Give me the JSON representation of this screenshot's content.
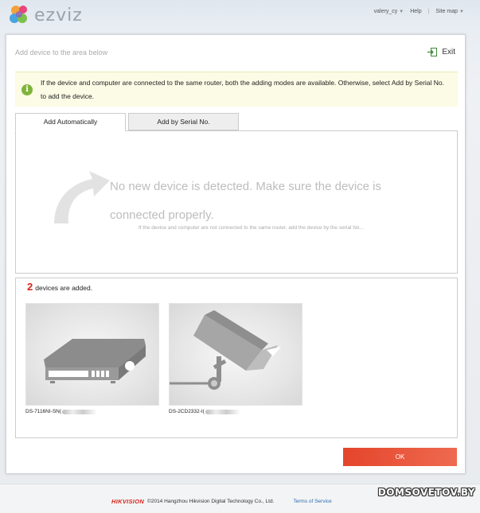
{
  "header": {
    "logo_text": "ezviz",
    "user": "valery_cy",
    "help": "Help",
    "site_map": "Site map"
  },
  "panel": {
    "title": "Add device to the area below",
    "exit_label": "Exit"
  },
  "notice": {
    "icon": "info-icon",
    "text": "If the device and computer are connected to the same router, both the adding modes are available. Otherwise, select Add by  Serial No. to add the device."
  },
  "tabs": [
    {
      "label": "Add Automatically",
      "active": true
    },
    {
      "label": "Add by Serial No.",
      "active": false
    }
  ],
  "detect": {
    "message": "No new device is detected. Make sure the device is connected properly.",
    "sub": "If the device and computer are not connected to the same router, add the device by the serial No..."
  },
  "added": {
    "count": "2",
    "label": "devices are added.",
    "devices": [
      {
        "name": "DS-7116NI-SN(",
        "icon": "nvr-icon"
      },
      {
        "name": "DS-2CD2332-I(",
        "icon": "camera-icon"
      }
    ]
  },
  "ok_label": "OK",
  "footer": {
    "brand": "HIKVISION",
    "copyright": "©2014 Hangzhou Hikvision Digital Technology Co., Ltd.",
    "terms": "Terms of Service"
  },
  "watermark": "DOMSOVETOV.BY",
  "colors": {
    "accent": "#e4452b",
    "count": "#d7261e",
    "notice_bg": "#fbfbe6",
    "info": "#7fb43a"
  }
}
